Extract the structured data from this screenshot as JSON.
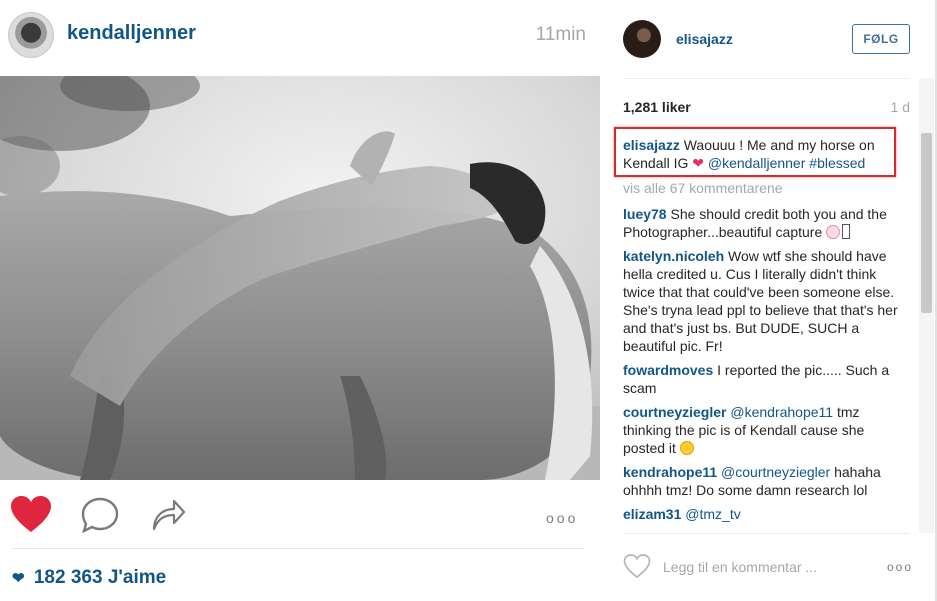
{
  "post": {
    "username": "kendalljenner",
    "time": "11min",
    "likes_count": "182 363",
    "likes_label": "J'aime",
    "liked": true,
    "more_label": "ooo"
  },
  "panel": {
    "username": "elisajazz",
    "follow_label": "FØLG",
    "likes": "1,281 liker",
    "age": "1 d",
    "caption": {
      "user": "elisajazz",
      "text": "Waouuu ! Me and my horse on Kendall IG",
      "heart": "❤",
      "mention": "@kendalljenner",
      "hashtag": "#blessed"
    },
    "view_all": "vis alle 67 kommentarene",
    "comments": [
      {
        "user": "luey78",
        "text": "She should credit both you and the Photographer...beautiful capture"
      },
      {
        "user": "katelyn.nicoleh",
        "text": "Wow wtf she should have hella credited u. Cus I literally didn't think twice that that could've been someone else. She's tryna lead ppl to believe that that's her and that's just bs. But DUDE, SUCH a beautiful pic. Fr!"
      },
      {
        "user": "fowardmoves",
        "text": "I reported the pic..... Such a scam"
      },
      {
        "user": "courtneyziegler",
        "mention": "@kendrahope11",
        "text": "tmz thinking the pic is of Kendall cause she posted it"
      },
      {
        "user": "kendrahope11",
        "mention": "@courtneyziegler",
        "text": "hahaha ohhhh tmz! Do some damn research lol"
      },
      {
        "user": "elizam31",
        "mention": "@tmz_tv",
        "text": ""
      }
    ],
    "comment_placeholder": "Legg til en kommentar ...",
    "comment_more": "ooo"
  },
  "colors": {
    "link": "#125688",
    "heart": "#e0253f",
    "highlight_box": "#d12b2b",
    "follow_border": "#3f729b"
  },
  "icons": [
    "heart-icon",
    "comment-bubble-icon",
    "share-arrow-icon",
    "heart-outline-icon",
    "more-options-icon"
  ]
}
